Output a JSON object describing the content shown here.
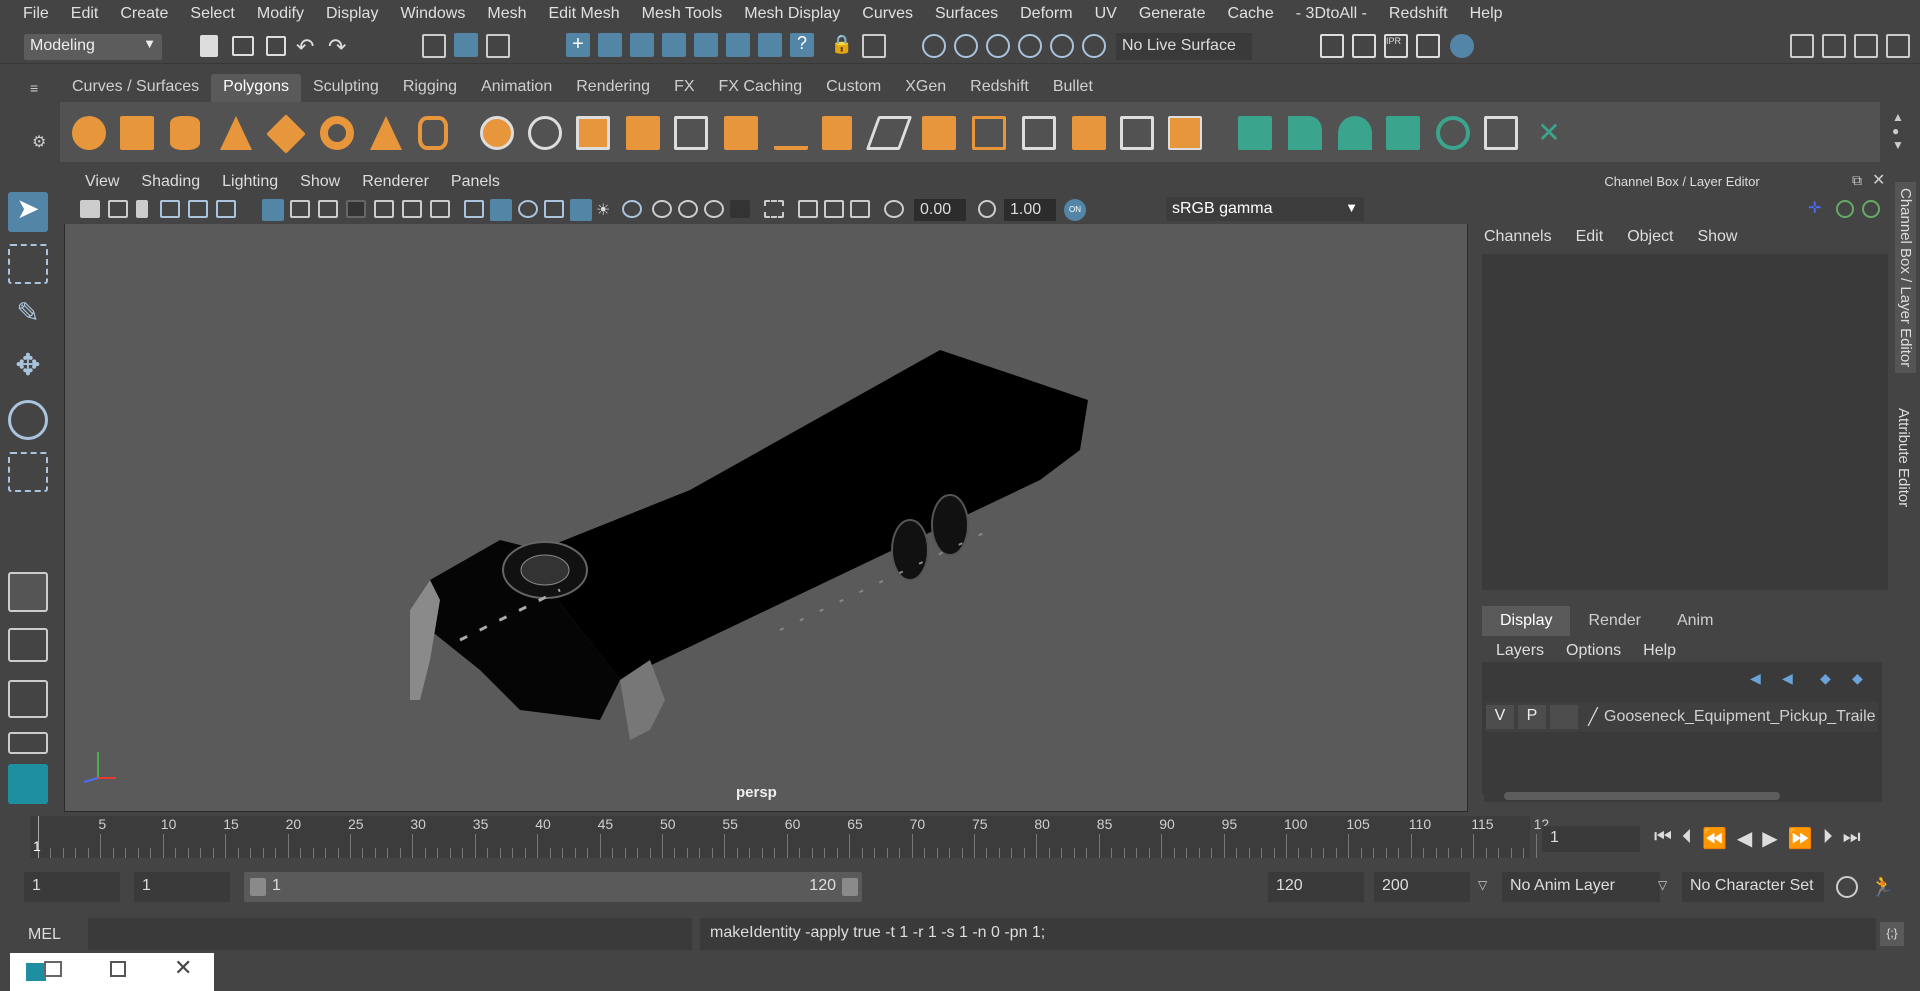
{
  "menu": [
    "File",
    "Edit",
    "Create",
    "Select",
    "Modify",
    "Display",
    "Windows",
    "Mesh",
    "Edit Mesh",
    "Mesh Tools",
    "Mesh Display",
    "Curves",
    "Surfaces",
    "Deform",
    "UV",
    "Generate",
    "Cache",
    "- 3DtoAll -",
    "Redshift",
    "Help"
  ],
  "status": {
    "mode": "Modeling",
    "live_surface": "No Live Surface"
  },
  "shelf_tabs": [
    "Curves / Surfaces",
    "Polygons",
    "Sculpting",
    "Rigging",
    "Animation",
    "Rendering",
    "FX",
    "FX Caching",
    "Custom",
    "XGen",
    "Redshift",
    "Bullet"
  ],
  "active_shelf_tab": "Polygons",
  "viewport": {
    "menu": [
      "View",
      "Shading",
      "Lighting",
      "Show",
      "Renderer",
      "Panels"
    ],
    "exposure": "0.00",
    "gamma_value": "1.00",
    "color_space": "sRGB gamma",
    "camera_label": "persp"
  },
  "channel_box": {
    "title": "Channel Box / Layer Editor",
    "menu": [
      "Channels",
      "Edit",
      "Object",
      "Show"
    ]
  },
  "layer_editor": {
    "tabs": [
      "Display",
      "Render",
      "Anim"
    ],
    "active_tab": "Display",
    "menu": [
      "Layers",
      "Options",
      "Help"
    ],
    "layer": {
      "v": "V",
      "p": "P",
      "name": "Gooseneck_Equipment_Pickup_Traile"
    }
  },
  "side_tabs": [
    "Channel Box / Layer Editor",
    "Attribute Editor"
  ],
  "timeline": {
    "ticks": [
      "5",
      "10",
      "15",
      "20",
      "25",
      "30",
      "35",
      "40",
      "45",
      "50",
      "55",
      "60",
      "65",
      "70",
      "75",
      "80",
      "85",
      "90",
      "95",
      "100",
      "105",
      "110",
      "115",
      "12"
    ],
    "current_frame_marker": "1",
    "current_frame": "1"
  },
  "range": {
    "start": "1",
    "playback_start": "1",
    "slider_start": "1",
    "slider_end": "120",
    "playback_end": "120",
    "end": "200",
    "anim_layer": "No Anim Layer",
    "character_set": "No Character Set"
  },
  "command": {
    "label": "MEL",
    "result": "makeIdentity -apply true -t 1 -r 1 -s 1 -n 0 -pn 1;"
  },
  "colors": {
    "accent": "#5285a6",
    "shelf_orange": "#e8963c",
    "shelf_teal": "#3aa58c"
  }
}
